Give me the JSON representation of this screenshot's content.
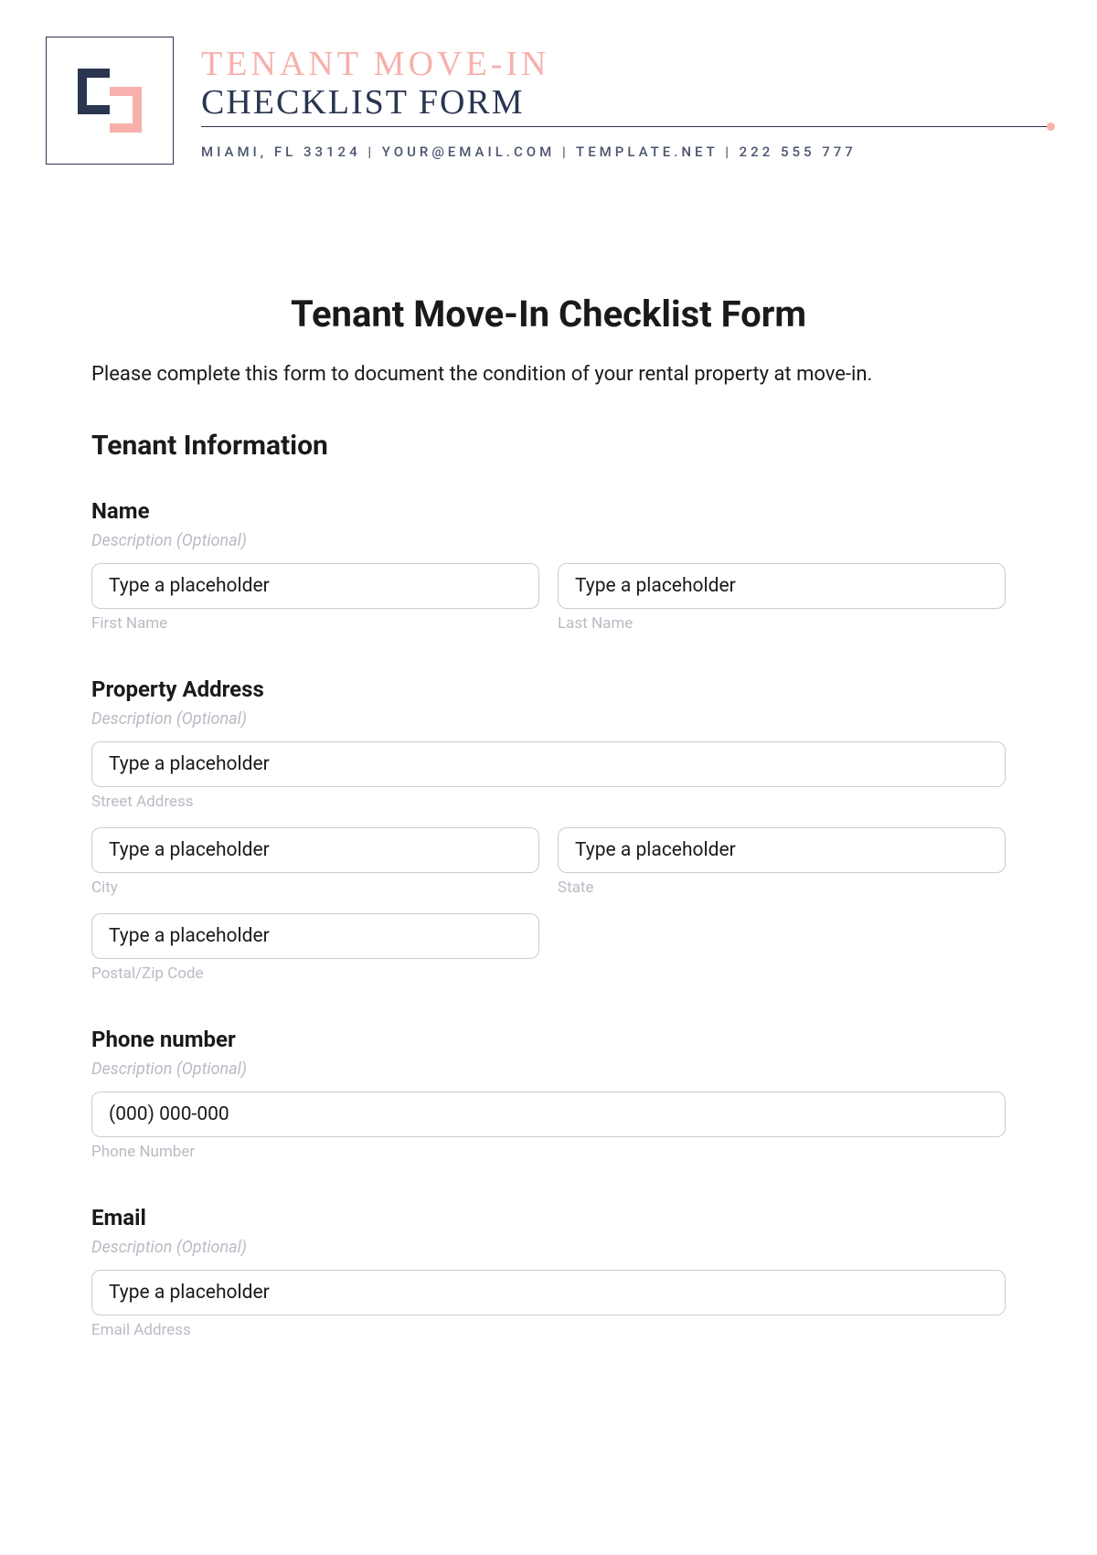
{
  "header": {
    "title_line1": "TENANT MOVE-IN",
    "title_line2": "CHECKLIST FORM",
    "contact": "MIAMI, FL 33124 | YOUR@EMAIL.COM | TEMPLATE.NET | 222 555 777"
  },
  "form": {
    "title": "Tenant Move-In Checklist Form",
    "intro": "Please complete this form to document the condition of your rental property at move-in.",
    "section_title": "Tenant Information",
    "desc_optional": "Description (Optional)",
    "placeholder_generic": "Type a placeholder",
    "name": {
      "label": "Name",
      "first_sub": "First Name",
      "last_sub": "Last Name"
    },
    "address": {
      "label": "Property Address",
      "street_sub": "Street Address",
      "city_sub": "City",
      "state_sub": "State",
      "postal_sub": "Postal/Zip Code"
    },
    "phone": {
      "label": "Phone number",
      "placeholder": "(000) 000-000",
      "sub": "Phone Number"
    },
    "email": {
      "label": "Email",
      "sub": "Email Address"
    }
  }
}
